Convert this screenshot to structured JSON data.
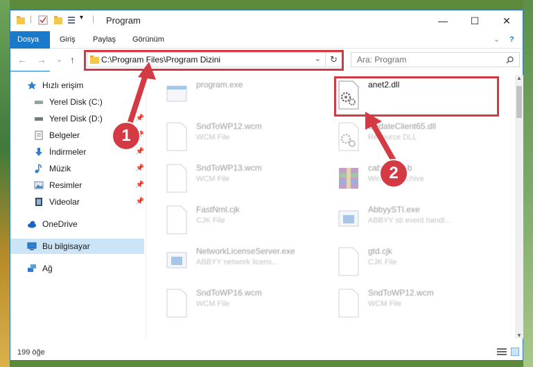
{
  "window": {
    "title": "Program",
    "controls": {
      "minimize": "—",
      "maximize": "☐",
      "close": "✕"
    }
  },
  "ribbon": {
    "tabs": [
      "Dosya",
      "Giriş",
      "Paylaş",
      "Görünüm"
    ],
    "help": "?"
  },
  "navigation": {
    "back": "←",
    "forward": "→",
    "recent": "⌄",
    "up": "↑",
    "address": "C:\\Program Files\\Program Dizini",
    "refresh": "↻",
    "search_placeholder": "Ara: Program"
  },
  "sidebar": {
    "items": [
      {
        "label": "Hızlı erişim",
        "icon": "star-icon",
        "pinned": false
      },
      {
        "label": "Yerel Disk (C:)",
        "icon": "drive-icon",
        "pinned": false
      },
      {
        "label": "Yerel Disk (D:)",
        "icon": "drive-icon",
        "pinned": true
      },
      {
        "label": "Belgeler",
        "icon": "documents-icon",
        "pinned": true
      },
      {
        "label": "İndirmeler",
        "icon": "download-icon",
        "pinned": true
      },
      {
        "label": "Müzik",
        "icon": "music-icon",
        "pinned": true
      },
      {
        "label": "Resimler",
        "icon": "pictures-icon",
        "pinned": true
      },
      {
        "label": "Videolar",
        "icon": "video-icon",
        "pinned": true
      },
      {
        "label": "OneDrive",
        "icon": "cloud-icon",
        "pinned": false
      },
      {
        "label": "Bu bilgisayar",
        "icon": "computer-icon",
        "pinned": false,
        "selected": true
      },
      {
        "label": "Ağ",
        "icon": "network-icon",
        "pinned": false
      }
    ]
  },
  "files": [
    {
      "name": "program.exe",
      "type": "",
      "icon": "exe-icon"
    },
    {
      "name": "anet2.dll",
      "type": "",
      "icon": "dll-gear-icon"
    },
    {
      "name": "SndToWP12.wcm",
      "type": "WCM File",
      "icon": "file-icon"
    },
    {
      "name": "UpdateClient65.dll",
      "type": "Resource DLL",
      "icon": "dll-gear-icon"
    },
    {
      "name": "SndToWP13.wcm",
      "type": "WCM File",
      "icon": "file-icon"
    },
    {
      "name": "cabfiles.cab",
      "type": "WinRAR archive",
      "icon": "archive-icon"
    },
    {
      "name": "FastNml.cjk",
      "type": "CJK File",
      "icon": "file-icon"
    },
    {
      "name": "AbbyySTI.exe",
      "type": "ABBYY sti event handl...",
      "icon": "exe-icon"
    },
    {
      "name": "NetworkLicenseServer.exe",
      "type": "ABBYY network licens...",
      "icon": "exe-icon"
    },
    {
      "name": "gtd.cjk",
      "type": "CJK File",
      "icon": "file-icon"
    },
    {
      "name": "SndToWP16.wcm",
      "type": "WCM File",
      "icon": "file-icon"
    },
    {
      "name": "SndToWP12.wcm",
      "type": "WCM File",
      "icon": "file-icon"
    }
  ],
  "annotations": {
    "step1": "1",
    "step2": "2"
  },
  "status": {
    "count": "199 öğe"
  }
}
